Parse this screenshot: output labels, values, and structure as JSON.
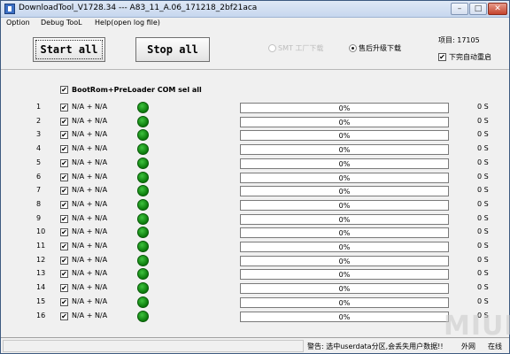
{
  "window": {
    "title": "DownloadTool_V1728.34 --- A83_11_A.06_171218_2bf21aca"
  },
  "menu": {
    "items": [
      "Option",
      "Debug TooL",
      "Help(open log file)"
    ]
  },
  "toolbar": {
    "start_label": "Start all",
    "stop_label": "Stop all",
    "radio1_label": "SMT 工厂下载",
    "radio2_label": "售后升级下载",
    "item_label": "项目:  17105",
    "reboot_label": "下完自动重启",
    "reboot_checked": true
  },
  "ports": {
    "select_all_label": "BootRom+PreLoader COM sel all",
    "rows": [
      {
        "index": "1",
        "port": "N/A + N/A",
        "progress": "0%",
        "time": "0 S"
      },
      {
        "index": "2",
        "port": "N/A + N/A",
        "progress": "0%",
        "time": "0 S"
      },
      {
        "index": "3",
        "port": "N/A + N/A",
        "progress": "0%",
        "time": "0 S"
      },
      {
        "index": "4",
        "port": "N/A + N/A",
        "progress": "0%",
        "time": "0 S"
      },
      {
        "index": "5",
        "port": "N/A + N/A",
        "progress": "0%",
        "time": "0 S"
      },
      {
        "index": "6",
        "port": "N/A + N/A",
        "progress": "0%",
        "time": "0 S"
      },
      {
        "index": "7",
        "port": "N/A + N/A",
        "progress": "0%",
        "time": "0 S"
      },
      {
        "index": "8",
        "port": "N/A + N/A",
        "progress": "0%",
        "time": "0 S"
      },
      {
        "index": "9",
        "port": "N/A + N/A",
        "progress": "0%",
        "time": "0 S"
      },
      {
        "index": "10",
        "port": "N/A + N/A",
        "progress": "0%",
        "time": "0 S"
      },
      {
        "index": "11",
        "port": "N/A + N/A",
        "progress": "0%",
        "time": "0 S"
      },
      {
        "index": "12",
        "port": "N/A + N/A",
        "progress": "0%",
        "time": "0 S"
      },
      {
        "index": "13",
        "port": "N/A + N/A",
        "progress": "0%",
        "time": "0 S"
      },
      {
        "index": "14",
        "port": "N/A + N/A",
        "progress": "0%",
        "time": "0 S"
      },
      {
        "index": "15",
        "port": "N/A + N/A",
        "progress": "0%",
        "time": "0 S"
      },
      {
        "index": "16",
        "port": "N/A + N/A",
        "progress": "0%",
        "time": "0 S"
      }
    ]
  },
  "status": {
    "warning": "警告: 选中userdata分区,会丢失用户数据!!",
    "pane2": "外网",
    "pane3": "在线"
  },
  "watermark": "MIUI",
  "colors": {
    "led_ok": "#0b7a0b",
    "title_bg": "#c6d7ee"
  }
}
